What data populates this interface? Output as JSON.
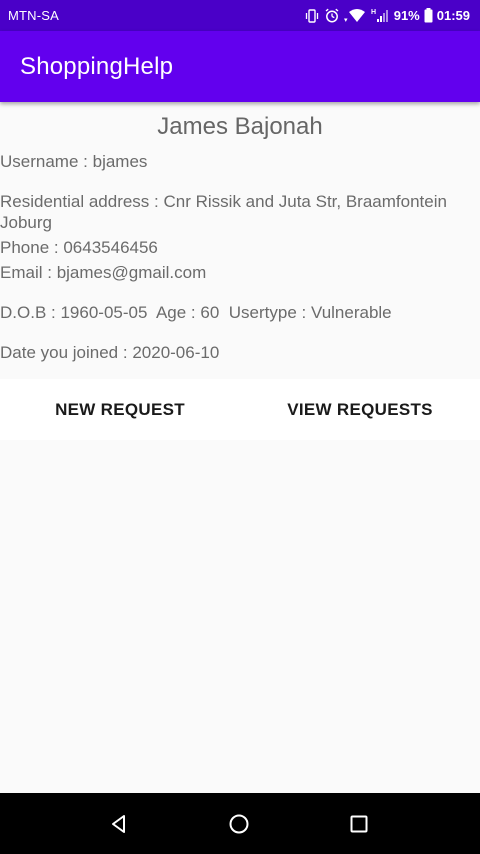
{
  "status_bar": {
    "carrier": "MTN-SA",
    "battery_percent": "91%",
    "time": "01:59",
    "network_type": "H",
    "icons": [
      "vibrate-icon",
      "alarm-icon",
      "wifi-icon",
      "signal-icon",
      "battery-icon"
    ]
  },
  "app_bar": {
    "title": "ShoppingHelp"
  },
  "profile": {
    "name": "James Bajonah",
    "username_label": "Username :",
    "username": "bjames",
    "address_label": "Residential address :",
    "address": "Cnr Rissik and Juta Str, Braamfontein Joburg",
    "phone_label": "Phone :",
    "phone": "0643546456",
    "email_label": "Email :",
    "email": "bjames@gmail.com",
    "dob_label": "D.O.B :",
    "dob": "1960-05-05",
    "age_label": "Age :",
    "age": "60",
    "usertype_label": "Usertype :",
    "usertype": "Vulnerable",
    "joined_label": "Date you joined :",
    "joined": "2020-06-10"
  },
  "actions": {
    "new_request": "NEW REQUEST",
    "view_requests": "VIEW REQUESTS"
  },
  "nav_bar": {
    "icons": [
      "back-icon",
      "home-icon",
      "recents-icon"
    ]
  },
  "colors": {
    "status_bar": "#4a00c8",
    "app_bar": "#6200ee",
    "background": "#fafafa",
    "text": "#6b6b6b"
  }
}
